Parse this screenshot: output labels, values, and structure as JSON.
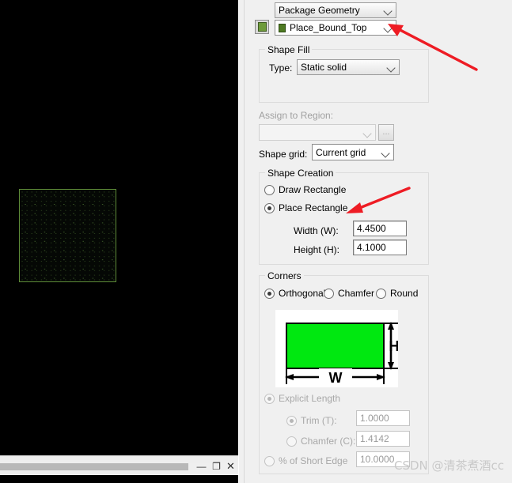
{
  "canvas": {
    "shape_name": "place-bound-rectangle",
    "shape_border_color": "#5e8c38",
    "background_color": "#000000",
    "window_buttons": {
      "minimize": "—",
      "maximize": "❐",
      "close": "✕"
    }
  },
  "panel": {
    "geometry_class": {
      "value": "Package Geometry"
    },
    "subclass": {
      "value": "Place_Bound_Top",
      "swatch_color": "#4e7a22"
    },
    "shape_fill": {
      "title": "Shape Fill",
      "type_label": "Type:",
      "type_value": "Static solid"
    },
    "assign_region": {
      "label": "Assign to Region:",
      "value": "",
      "ellipsis_label": "..."
    },
    "shape_grid": {
      "label": "Shape grid:",
      "value": "Current grid"
    },
    "shape_creation": {
      "title": "Shape Creation",
      "options": [
        {
          "label": "Draw Rectangle",
          "checked": false
        },
        {
          "label": "Place Rectangle",
          "checked": true
        }
      ],
      "width_label": "Width (W):",
      "width_value": "4.4500",
      "height_label": "Height (H):",
      "height_value": "4.1000"
    },
    "corners": {
      "title": "Corners",
      "options": [
        {
          "label": "Orthogonal",
          "checked": true
        },
        {
          "label": "Chamfer",
          "checked": false
        },
        {
          "label": "Round",
          "checked": false
        }
      ],
      "preview": {
        "rect_color": "#00e810",
        "width_label": "W",
        "height_label": "H"
      },
      "explicit_length": {
        "label": "Explicit Length",
        "checked": true,
        "enabled": false
      },
      "trim": {
        "label": "Trim (T):",
        "checked": true,
        "value": "1.0000"
      },
      "chamfer": {
        "label": "Chamfer (C):",
        "checked": false,
        "value": "1.4142"
      },
      "short_edge": {
        "label": "% of Short Edge",
        "checked": false,
        "value": "10.0000"
      }
    }
  },
  "watermark": {
    "text": "CSDN @清茶煮酒cc"
  }
}
